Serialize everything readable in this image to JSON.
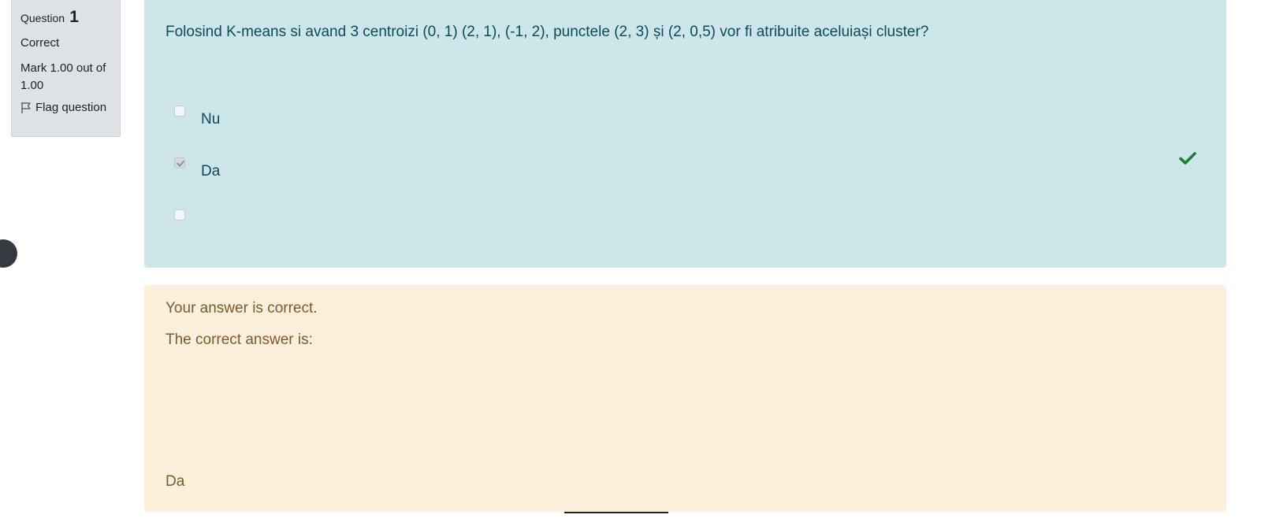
{
  "info": {
    "question_label": "Question",
    "question_number": "1",
    "status": "Correct",
    "mark": "Mark 1.00 out of 1.00",
    "flag_label": "Flag question"
  },
  "question": {
    "text": "Folosind K-means si avand 3 centroizi (0, 1) (2, 1), (-1, 2), punctele (2, 3) și (2, 0,5) vor fi atribuite aceluiași cluster?",
    "options": [
      {
        "label": "Nu",
        "checked": false
      },
      {
        "label": "Da",
        "checked": true
      },
      {
        "label": "",
        "checked": false
      }
    ]
  },
  "feedback": {
    "result": "Your answer is correct.",
    "correct_answer_label": "The correct answer is:",
    "correct_answer_value": "Da"
  },
  "colors": {
    "question_bg": "#cce6ea",
    "feedback_bg": "#fcefdc",
    "correct_mark": "#1e7e34"
  }
}
